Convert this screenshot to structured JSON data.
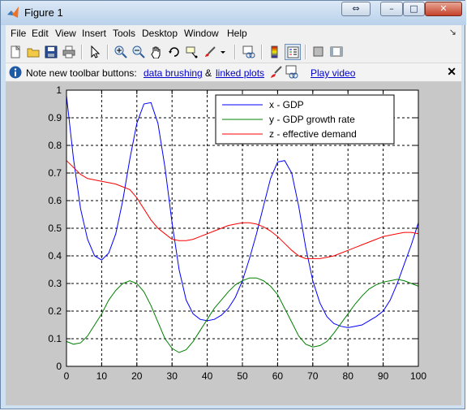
{
  "window": {
    "title": "Figure 1",
    "extra_button": "⇔",
    "minimize": "–",
    "maximize": "□",
    "close": "✕"
  },
  "menu": [
    {
      "label": "File"
    },
    {
      "label": "Edit"
    },
    {
      "label": "View"
    },
    {
      "label": "Insert"
    },
    {
      "label": "Tools"
    },
    {
      "label": "Desktop"
    },
    {
      "label": "Window"
    },
    {
      "label": "Help"
    }
  ],
  "menu_corner": "↘",
  "infobar": {
    "note": "Note new toolbar buttons:",
    "link_brushing": "data brushing",
    "amp": "&",
    "link_linked": "linked plots",
    "link_video": "Play video",
    "close": "✕"
  },
  "toolbar_icons": [
    "new-figure-icon",
    "open-file-icon",
    "save-icon",
    "print-icon",
    "edit-plot-arrow-icon",
    "zoom-in-icon",
    "zoom-out-icon",
    "pan-hand-icon",
    "rotate-3d-icon",
    "data-cursor-icon",
    "brush-icon",
    "link-plot-icon",
    "colorbar-icon",
    "legend-icon",
    "hide-plot-tools-icon",
    "show-plot-tools-icon"
  ],
  "chart_data": {
    "type": "line",
    "title": "",
    "xlabel": "",
    "ylabel": "",
    "xlim": [
      0,
      100
    ],
    "ylim": [
      0,
      1
    ],
    "xticks": [
      0,
      10,
      20,
      30,
      40,
      50,
      60,
      70,
      80,
      90,
      100
    ],
    "yticks": [
      0,
      0.1,
      0.2,
      0.3,
      0.4,
      0.5,
      0.6,
      0.7,
      0.8,
      0.9,
      1
    ],
    "grid": true,
    "legend_position": "top-right",
    "x": [
      0,
      2,
      4,
      6,
      8,
      10,
      12,
      14,
      16,
      18,
      20,
      22,
      24,
      26,
      28,
      30,
      32,
      34,
      36,
      38,
      40,
      42,
      44,
      46,
      48,
      50,
      52,
      54,
      56,
      58,
      60,
      62,
      64,
      66,
      68,
      70,
      72,
      74,
      76,
      78,
      80,
      82,
      84,
      86,
      88,
      90,
      92,
      94,
      96,
      98,
      100
    ],
    "series": [
      {
        "name": "x - GDP",
        "color": "#0000ff",
        "values": [
          0.98,
          0.75,
          0.57,
          0.46,
          0.4,
          0.385,
          0.41,
          0.48,
          0.6,
          0.75,
          0.88,
          0.95,
          0.955,
          0.88,
          0.72,
          0.52,
          0.35,
          0.24,
          0.19,
          0.17,
          0.165,
          0.17,
          0.185,
          0.21,
          0.25,
          0.31,
          0.39,
          0.48,
          0.58,
          0.68,
          0.74,
          0.745,
          0.7,
          0.58,
          0.43,
          0.31,
          0.23,
          0.18,
          0.155,
          0.145,
          0.14,
          0.145,
          0.15,
          0.165,
          0.18,
          0.2,
          0.24,
          0.3,
          0.37,
          0.44,
          0.52
        ]
      },
      {
        "name": "y - GDP growth rate",
        "color": "#008000",
        "values": [
          0.09,
          0.08,
          0.085,
          0.11,
          0.15,
          0.19,
          0.24,
          0.275,
          0.3,
          0.31,
          0.3,
          0.27,
          0.22,
          0.16,
          0.1,
          0.065,
          0.05,
          0.06,
          0.09,
          0.13,
          0.17,
          0.21,
          0.24,
          0.27,
          0.295,
          0.31,
          0.32,
          0.32,
          0.31,
          0.29,
          0.26,
          0.21,
          0.16,
          0.11,
          0.08,
          0.07,
          0.075,
          0.09,
          0.12,
          0.155,
          0.19,
          0.225,
          0.255,
          0.28,
          0.295,
          0.305,
          0.31,
          0.315,
          0.31,
          0.3,
          0.29
        ]
      },
      {
        "name": "z - effective demand",
        "color": "#ff0000",
        "values": [
          0.745,
          0.72,
          0.695,
          0.68,
          0.675,
          0.67,
          0.665,
          0.66,
          0.65,
          0.64,
          0.61,
          0.57,
          0.53,
          0.5,
          0.48,
          0.46,
          0.455,
          0.455,
          0.46,
          0.47,
          0.48,
          0.49,
          0.5,
          0.51,
          0.515,
          0.52,
          0.52,
          0.515,
          0.505,
          0.49,
          0.47,
          0.445,
          0.42,
          0.4,
          0.39,
          0.39,
          0.39,
          0.395,
          0.4,
          0.41,
          0.42,
          0.43,
          0.44,
          0.45,
          0.46,
          0.47,
          0.475,
          0.48,
          0.485,
          0.485,
          0.48
        ]
      }
    ]
  }
}
